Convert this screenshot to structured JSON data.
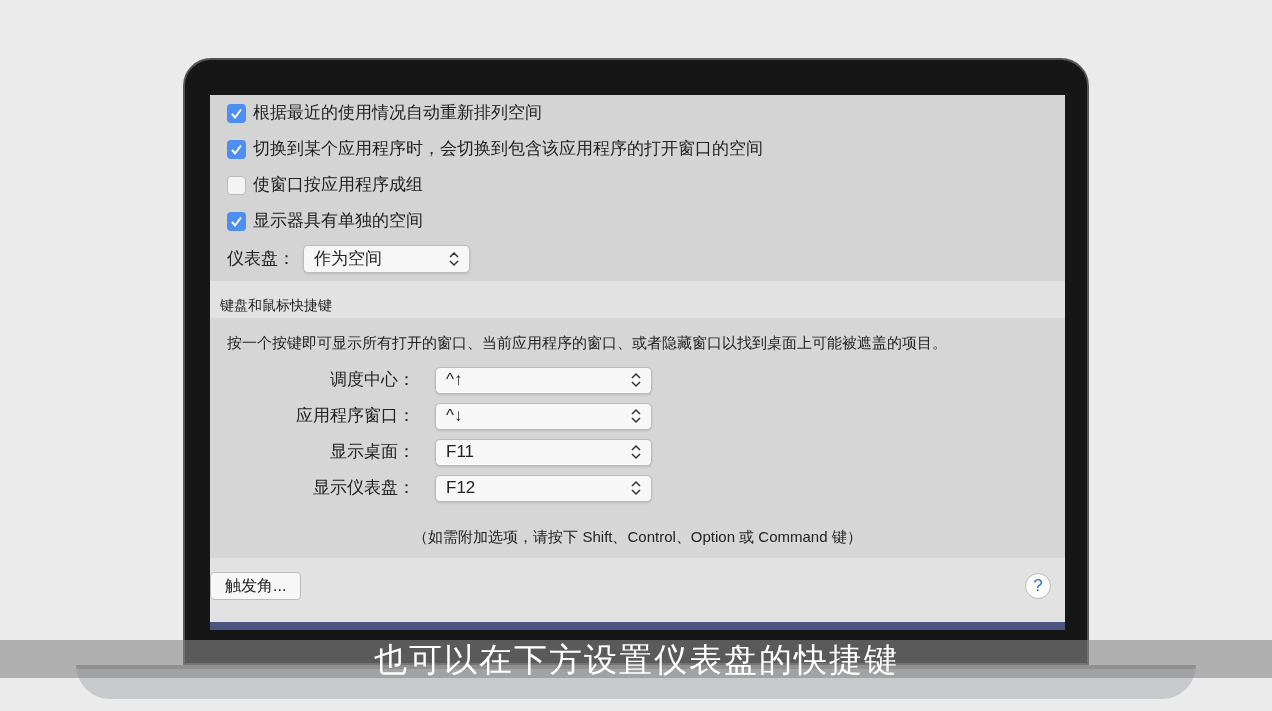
{
  "checkboxes": [
    {
      "label": "根据最近的使用情况自动重新排列空间",
      "checked": true
    },
    {
      "label": "切换到某个应用程序时，会切换到包含该应用程序的打开窗口的空间",
      "checked": true
    },
    {
      "label": "使窗口按应用程序成组",
      "checked": false
    },
    {
      "label": "显示器具有单独的空间",
      "checked": true
    }
  ],
  "dashboard": {
    "label": "仪表盘：",
    "value": "作为空间"
  },
  "shortcuts": {
    "title": "键盘和鼠标快捷键",
    "description": "按一个按键即可显示所有打开的窗口、当前应用程序的窗口、或者隐藏窗口以找到桌面上可能被遮盖的项目。",
    "rows": [
      {
        "label": "调度中心：",
        "value": "^↑"
      },
      {
        "label": "应用程序窗口：",
        "value": "^↓"
      },
      {
        "label": "显示桌面：",
        "value": "F11"
      },
      {
        "label": "显示仪表盘：",
        "value": "F12"
      }
    ],
    "note": "（如需附加选项，请按下 Shift、Control、Option 或 Command 键）"
  },
  "hot_corners_button": "触发角...",
  "help_button": "?",
  "subtitle": "也可以在下方设置仪表盘的快捷键"
}
